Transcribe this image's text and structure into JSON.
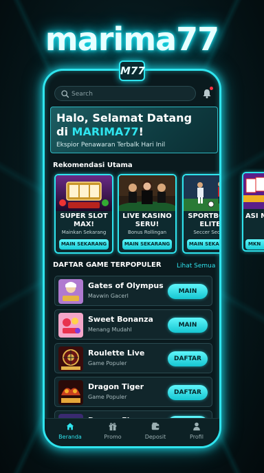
{
  "brand": "marima77",
  "badge": "M77",
  "search": {
    "placeholder": "Search"
  },
  "banner": {
    "title_line1": "Halo, Selamat Datang",
    "title_prefix": "di ",
    "title_highlight": "MARIMA77",
    "title_suffix": "!",
    "subtitle": "Ekspior Penawaran Terbalk Hari Inil"
  },
  "recommend": {
    "heading": "Rekomendasi Utama",
    "cards": [
      {
        "title": "SUPER SLOT MAX!",
        "subtitle": "Mainkan Sekarang",
        "button": "MAIN SEKARANG",
        "art_text": "SLT MAHJONG"
      },
      {
        "title": "LIVE KASINO SERU!",
        "subtitle": "Bonus Rollingan",
        "button": "MAIN SEKARANG",
        "art_text": ""
      },
      {
        "title": "SPORTBOOK ELITE!",
        "subtitle": "Seccer Seocoel",
        "button": "MAIN SEKARANG",
        "art_text": ""
      },
      {
        "title": "ASI M",
        "subtitle": "",
        "button": "MKN",
        "art_text": "ASIA"
      }
    ]
  },
  "popular": {
    "heading": "DAFTAR GAME TERPOPULER",
    "see_all": "Lihat Semua",
    "games": [
      {
        "name": "Gates of Olympus",
        "sub": "Mavwin Gacerl",
        "button": "MAIN",
        "thumb_text": ""
      },
      {
        "name": "Sweet Bonanza",
        "sub": "Menang Mudahl",
        "button": "MAIN",
        "thumb_text": ""
      },
      {
        "name": "Roulette Live",
        "sub": "Game Populer",
        "button": "DAFTAR",
        "thumb_text": "ROULETTE"
      },
      {
        "name": "Dragon Tiger",
        "sub": "Game Populer",
        "button": "DAFTAR",
        "thumb_text": "DRAGON TIGER"
      },
      {
        "name": "Dragon Figer",
        "sub": "",
        "button": "",
        "thumb_text": ""
      }
    ]
  },
  "nav": [
    {
      "label": "Beranda",
      "icon": "home-icon",
      "active": true
    },
    {
      "label": "Promo",
      "icon": "gift-icon",
      "active": false
    },
    {
      "label": "Deposit",
      "icon": "wallet-icon",
      "active": false
    },
    {
      "label": "Profil",
      "icon": "user-icon",
      "active": false
    }
  ],
  "colors": {
    "accent": "#2fe4ee",
    "background": "#06181c",
    "notification": "#ff3344"
  }
}
